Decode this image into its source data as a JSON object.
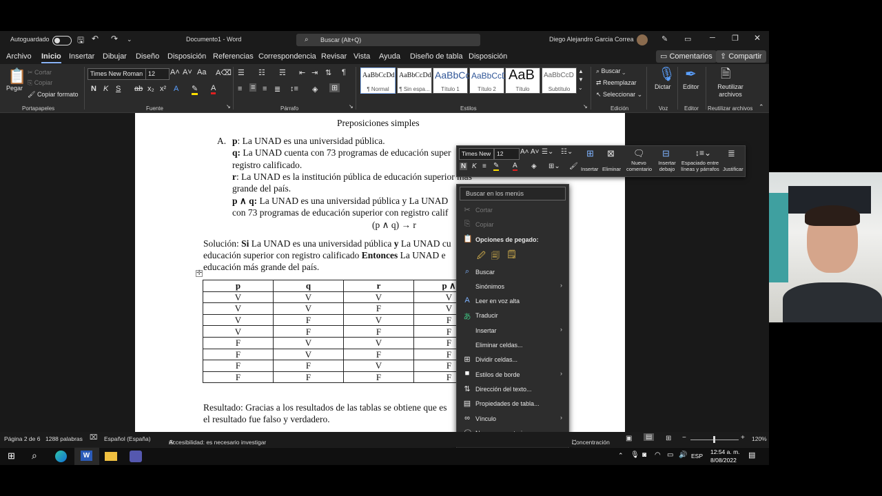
{
  "titlebar": {
    "autosave_label": "Autoguardado",
    "doc_title": "Documento1 - Word",
    "search_placeholder": "Buscar (Alt+Q)",
    "user_name": "Diego Alejandro Garcia Correa"
  },
  "menubar": {
    "tabs": [
      "Archivo",
      "Inicio",
      "Insertar",
      "Dibujar",
      "Diseño",
      "Disposición",
      "Referencias",
      "Correspondencia",
      "Revisar",
      "Vista",
      "Ayuda",
      "Diseño de tabla",
      "Disposición"
    ],
    "comments_label": "Comentarios",
    "share_label": "Compartir"
  },
  "ribbon": {
    "clipboard": {
      "paste": "Pegar",
      "cut": "Cortar",
      "copy": "Copiar",
      "format_painter": "Copiar formato",
      "label": "Portapapeles"
    },
    "font": {
      "family": "Times New Roman",
      "size": "12",
      "label": "Fuente"
    },
    "paragraph": {
      "label": "Párrafo"
    },
    "styles": {
      "label": "Estilos",
      "cards": [
        {
          "preview": "AaBbCcDd",
          "name": "¶ Normal"
        },
        {
          "preview": "AaBbCcDd",
          "name": "¶ Sin espa..."
        },
        {
          "preview": "AaBbCc",
          "name": "Título 1"
        },
        {
          "preview": "AaBbCcD",
          "name": "Título 2"
        },
        {
          "preview": "AaB",
          "name": "Título"
        },
        {
          "preview": "AaBbCcD",
          "name": "Subtítulo"
        }
      ]
    },
    "editing": {
      "find": "Buscar",
      "replace": "Reemplazar",
      "select": "Seleccionar",
      "label": "Edición"
    },
    "voice": {
      "dictate": "Dictar",
      "label": "Voz"
    },
    "editor": {
      "editor": "Editor",
      "label": "Editor"
    },
    "reuse": {
      "reuse": "Reutilizar archivos",
      "label": "Reutilizar archivos"
    }
  },
  "document": {
    "heading": "Preposiciones simples",
    "item_a_marker": "A.",
    "lines": [
      {
        "bold": "p",
        "text": ": La UNAD es una universidad pública."
      },
      {
        "bold": "q:",
        "text": " La UNAD cuenta con 73 programas de educación super"
      },
      {
        "bold": "",
        "text": "registro calificado."
      },
      {
        "bold": "r",
        "text": ": La UNAD es la institución pública de educación superior más"
      },
      {
        "bold": "",
        "text": "grande del país."
      },
      {
        "bold": "p ∧ q:",
        "text": " La UNAD es una universidad pública y La UNAD"
      },
      {
        "bold": "",
        "text": "con 73 programas de educación superior con registro calif"
      }
    ],
    "formula": "(p ∧ q) → r",
    "solution_l1_a": "Solución: ",
    "solution_l1_b": "Si",
    "solution_l1_c": " La UNAD es una universidad pública ",
    "solution_l1_d": "y",
    "solution_l1_e": " La UNAD cu",
    "solution_l2_a": "educación superior con registro calificado ",
    "solution_l2_b": "Entonces",
    "solution_l2_c": " La UNAD e",
    "solution_l3": "educación más grande del país.",
    "truth_table": {
      "headers": [
        "p",
        "q",
        "r",
        "p ∧"
      ],
      "rows": [
        [
          "V",
          "V",
          "V",
          "V"
        ],
        [
          "V",
          "V",
          "F",
          "V"
        ],
        [
          "V",
          "F",
          "V",
          "F"
        ],
        [
          "V",
          "F",
          "F",
          "F"
        ],
        [
          "F",
          "V",
          "V",
          "F"
        ],
        [
          "F",
          "V",
          "F",
          "F"
        ],
        [
          "F",
          "F",
          "V",
          "F"
        ],
        [
          "F",
          "F",
          "F",
          "F"
        ]
      ]
    },
    "result_l1": "Resultado: Gracias a los resultados de las tablas se obtiene que es",
    "result_l2": "el resultado fue falso y verdadero."
  },
  "minibar": {
    "font": "Times New",
    "size": "12",
    "insert": "Insertar",
    "delete": "Eliminar",
    "new_comment": "Nuevo comentario",
    "insert_below": "Insertar debajo",
    "line_spacing": "Espaciado entre líneas y párrafos",
    "justify": "Justificar"
  },
  "context_menu": {
    "search_placeholder": "Buscar en los menús",
    "items": [
      "Cortar",
      "Copiar",
      "Opciones de pegado:",
      "Buscar",
      "Sinónimos",
      "Leer en voz alta",
      "Traducir",
      "Insertar",
      "Eliminar celdas...",
      "Dividir celdas...",
      "Estilos de borde",
      "Dirección del texto...",
      "Propiedades de tabla...",
      "Vínculo",
      "Nuevo comentario"
    ]
  },
  "status": {
    "page": "Página 2 de 6",
    "words": "1288 palabras",
    "language": "Español (España)",
    "accessibility": "Accesibilidad: es necesario investigar",
    "focus": "Concentración",
    "zoom": "120%"
  },
  "taskbar": {
    "lang": "ESP",
    "time": "12:54 a. m.",
    "date": "8/08/2022"
  },
  "colors": {
    "accent": "#8ab4f8",
    "ribbon_bg": "#2b2b2b",
    "page": "#ffffff"
  }
}
